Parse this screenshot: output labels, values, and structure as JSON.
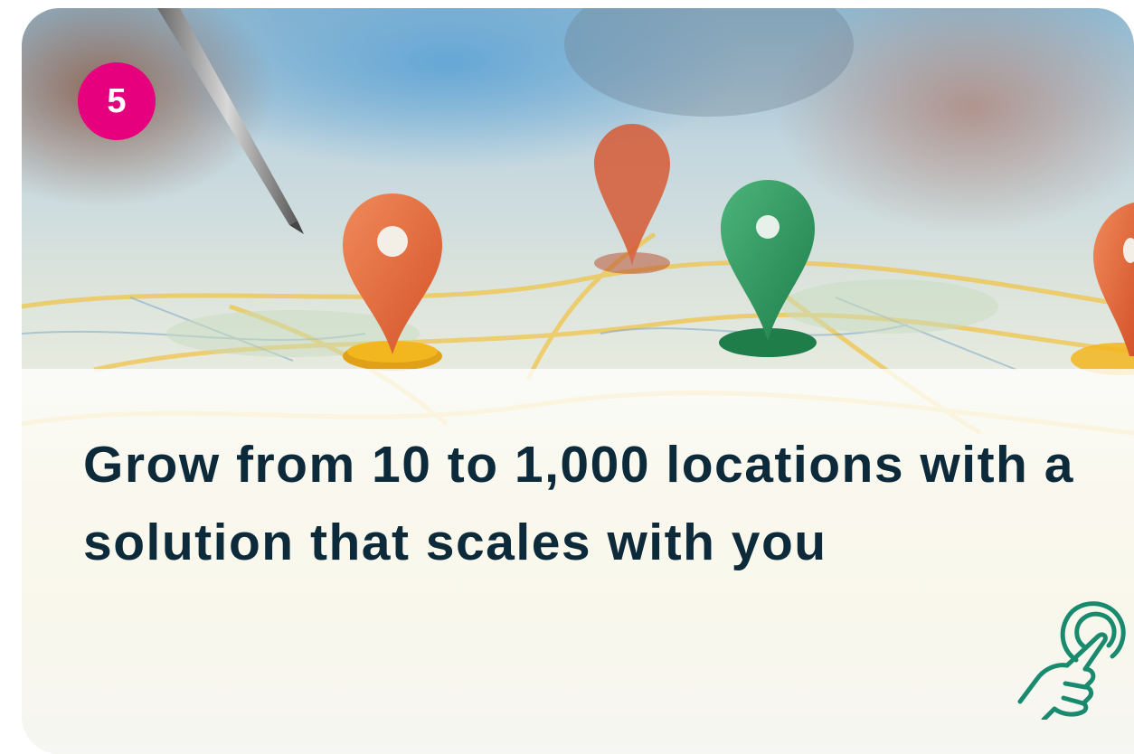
{
  "card": {
    "step_number": "5",
    "headline": "Grow from 10 to 1,000 locations with a solution that scales with you"
  },
  "photo": {
    "subject": "Map with location pins and a pen"
  },
  "icons": {
    "tap": "tap-gesture-icon"
  },
  "colors": {
    "badge": "#e6007e",
    "headline": "#0d2a3a",
    "icon": "#1a8a6e",
    "pin_orange": "#e8663a",
    "pin_green": "#2f9a5f",
    "pin_base_yellow": "#f2b61e"
  }
}
